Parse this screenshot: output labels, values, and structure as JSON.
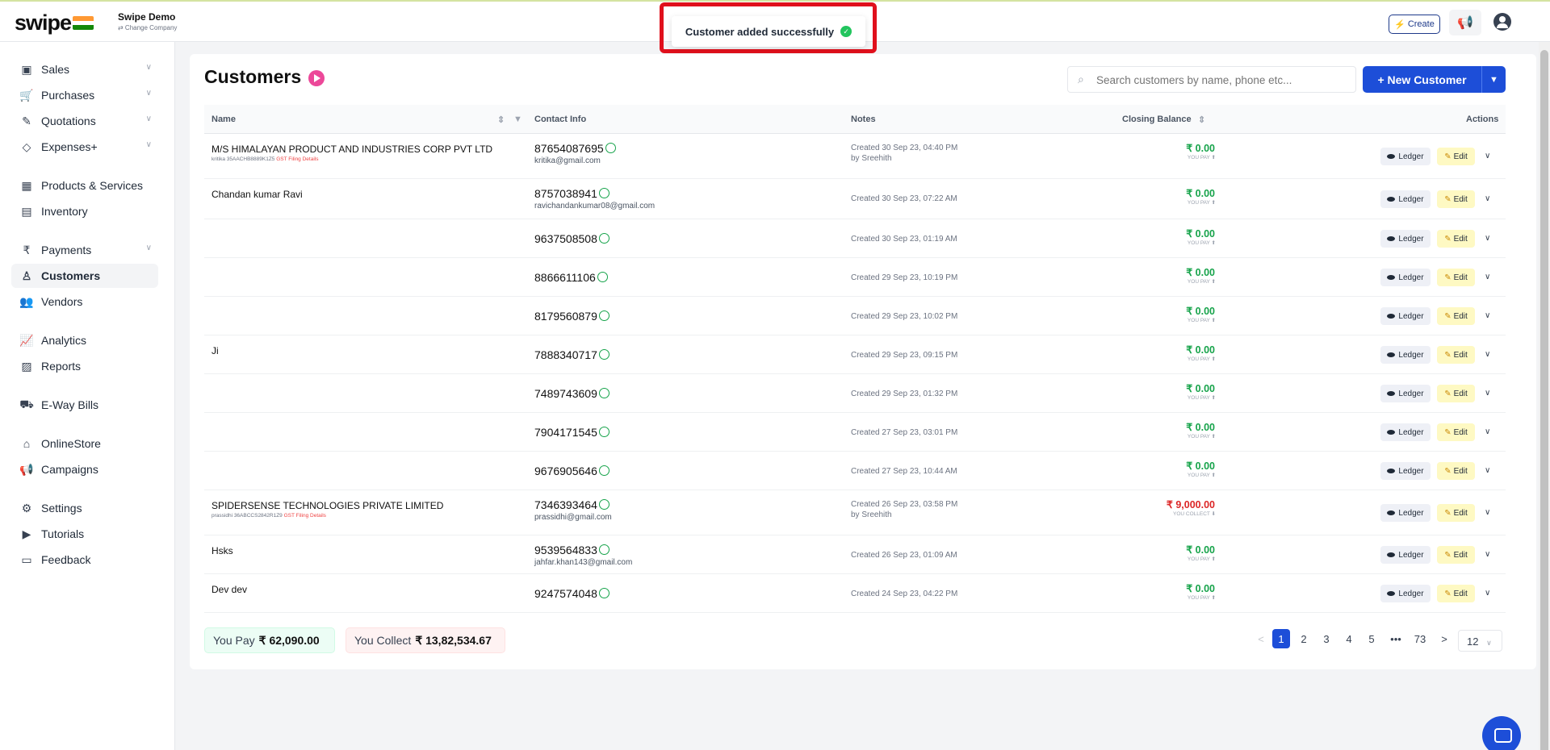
{
  "app": {
    "logo": "swipe",
    "company_name": "Swipe Demo",
    "change_company": "⇄ Change Company"
  },
  "toast": {
    "message": "Customer added successfully"
  },
  "header": {
    "create_label": "Create"
  },
  "sidebar": {
    "items": [
      {
        "label": "Sales",
        "icon": "sales-icon",
        "glyph": "▣",
        "chevron": true
      },
      {
        "label": "Purchases",
        "icon": "cart-icon",
        "glyph": "🛒",
        "chevron": true
      },
      {
        "label": "Quotations",
        "icon": "pencil-icon",
        "glyph": "✎",
        "chevron": true
      },
      {
        "label": "Expenses+",
        "icon": "tag-icon",
        "glyph": "◇",
        "chevron": true
      },
      {
        "label": "Products & Services",
        "icon": "products-icon",
        "glyph": "▦",
        "chevron": false
      },
      {
        "label": "Inventory",
        "icon": "inventory-icon",
        "glyph": "▤",
        "chevron": false
      },
      {
        "label": "Payments",
        "icon": "rupee-icon",
        "glyph": "₹",
        "chevron": true
      },
      {
        "label": "Customers",
        "icon": "user-icon",
        "glyph": "♙",
        "chevron": false,
        "active": true
      },
      {
        "label": "Vendors",
        "icon": "users-icon",
        "glyph": "👥",
        "chevron": false
      },
      {
        "label": "Analytics",
        "icon": "chart-icon",
        "glyph": "📈",
        "chevron": false
      },
      {
        "label": "Reports",
        "icon": "report-icon",
        "glyph": "▨",
        "chevron": false
      },
      {
        "label": "E-Way Bills",
        "icon": "truck-icon",
        "glyph": "⛟",
        "chevron": false
      },
      {
        "label": "OnlineStore",
        "icon": "store-icon",
        "glyph": "⌂",
        "chevron": false
      },
      {
        "label": "Campaigns",
        "icon": "megaphone-icon",
        "glyph": "📢",
        "chevron": false
      },
      {
        "label": "Settings",
        "icon": "settings-icon",
        "glyph": "⚙",
        "chevron": false
      },
      {
        "label": "Tutorials",
        "icon": "youtube-icon",
        "glyph": "▶",
        "chevron": false
      },
      {
        "label": "Feedback",
        "icon": "feedback-icon",
        "glyph": "▭",
        "chevron": false
      }
    ]
  },
  "page": {
    "title": "Customers",
    "search_placeholder": "Search customers by name, phone etc...",
    "new_customer_label": "+ New Customer"
  },
  "table": {
    "headers": {
      "name": "Name",
      "contact": "Contact Info",
      "notes": "Notes",
      "balance": "Closing Balance",
      "actions": "Actions"
    },
    "ledger_label": "Ledger",
    "edit_label": "Edit",
    "rows": [
      {
        "name": "M/S HIMALAYAN PRODUCT AND INDUSTRIES CORP PVT LTD",
        "sub": "kritika 35AACHB8889K1Z5",
        "gst": "GST Filing Details",
        "phone": "87654087695",
        "email": "kritika@gmail.com",
        "note": "Created 30 Sep 23, 04:40 PM",
        "note2": "by Sreehith",
        "balance": "₹ 0.00",
        "balance_label": "YOU PAY ⬆",
        "red": false
      },
      {
        "name": "Chandan kumar Ravi",
        "sub": "",
        "gst": "",
        "phone": "8757038941",
        "email": "ravichandankumar08@gmail.com",
        "note": "Created 30 Sep 23, 07:22 AM",
        "note2": "",
        "balance": "₹ 0.00",
        "balance_label": "YOU PAY ⬆",
        "red": false
      },
      {
        "name": "",
        "sub": "",
        "gst": "",
        "phone": "9637508508",
        "email": "",
        "note": "Created 30 Sep 23, 01:19 AM",
        "note2": "",
        "balance": "₹ 0.00",
        "balance_label": "YOU PAY ⬆",
        "red": false
      },
      {
        "name": "",
        "sub": "",
        "gst": "",
        "phone": "8866611106",
        "email": "",
        "note": "Created 29 Sep 23, 10:19 PM",
        "note2": "",
        "balance": "₹ 0.00",
        "balance_label": "YOU PAY ⬆",
        "red": false
      },
      {
        "name": "",
        "sub": "",
        "gst": "",
        "phone": "8179560879",
        "email": "",
        "note": "Created 29 Sep 23, 10:02 PM",
        "note2": "",
        "balance": "₹ 0.00",
        "balance_label": "YOU PAY ⬆",
        "red": false
      },
      {
        "name": "Ji",
        "sub": "",
        "gst": "",
        "phone": "7888340717",
        "email": "",
        "note": "Created 29 Sep 23, 09:15 PM",
        "note2": "",
        "balance": "₹ 0.00",
        "balance_label": "YOU PAY ⬆",
        "red": false
      },
      {
        "name": "",
        "sub": "",
        "gst": "",
        "phone": "7489743609",
        "email": "",
        "note": "Created 29 Sep 23, 01:32 PM",
        "note2": "",
        "balance": "₹ 0.00",
        "balance_label": "YOU PAY ⬆",
        "red": false
      },
      {
        "name": "",
        "sub": "",
        "gst": "",
        "phone": "7904171545",
        "email": "",
        "note": "Created 27 Sep 23, 03:01 PM",
        "note2": "",
        "balance": "₹ 0.00",
        "balance_label": "YOU PAY ⬆",
        "red": false
      },
      {
        "name": "",
        "sub": "",
        "gst": "",
        "phone": "9676905646",
        "email": "",
        "note": "Created 27 Sep 23, 10:44 AM",
        "note2": "",
        "balance": "₹ 0.00",
        "balance_label": "YOU PAY ⬆",
        "red": false
      },
      {
        "name": "SPIDERSENSE TECHNOLOGIES PRIVATE LIMITED",
        "sub": "prassidhi 36ABCCS2842R1Z9",
        "gst": "GST Filing Details",
        "phone": "7346393464",
        "email": "prassidhi@gmail.com",
        "note": "Created 26 Sep 23, 03:58 PM",
        "note2": "by Sreehith",
        "balance": "₹ 9,000.00",
        "balance_label": "YOU COLLECT ⬇",
        "red": true
      },
      {
        "name": "Hsks",
        "sub": "",
        "gst": "",
        "phone": "9539564833",
        "email": "jahfar.khan143@gmail.com",
        "note": "Created 26 Sep 23, 01:09 AM",
        "note2": "",
        "balance": "₹ 0.00",
        "balance_label": "YOU PAY ⬆",
        "red": false
      },
      {
        "name": "Dev dev",
        "sub": "",
        "gst": "",
        "phone": "9247574048",
        "email": "",
        "note": "Created 24 Sep 23, 04:22 PM",
        "note2": "",
        "balance": "₹ 0.00",
        "balance_label": "YOU PAY ⬆",
        "red": false
      }
    ]
  },
  "summary": {
    "pay_label": "You Pay",
    "pay_value": "₹ 62,090.00",
    "collect_label": "You Collect",
    "collect_value": "₹ 13,82,534.67"
  },
  "pagination": {
    "prev": "<",
    "pages": [
      "1",
      "2",
      "3",
      "4",
      "5",
      "•••",
      "73"
    ],
    "next": ">",
    "current": "1",
    "page_size": "12"
  }
}
